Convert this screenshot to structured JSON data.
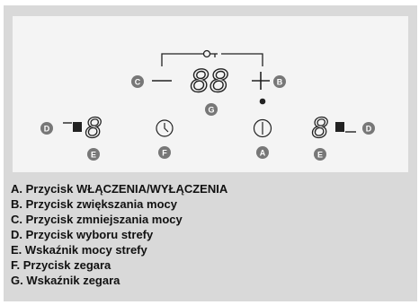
{
  "colors": {
    "panel_bg": "#f4f4f4",
    "frame_bg": "#d9d9d9",
    "line": "#222222",
    "badge_fill": "#777777",
    "badge_text": "#ffffff"
  },
  "icons": {
    "lock": "key-lock-icon",
    "minus": "minus-icon",
    "plus": "plus-icon",
    "timer": "clock-icon",
    "power": "power-icon",
    "zone_left": "zone-select-left-icon",
    "zone_right": "zone-select-right-icon"
  },
  "display": {
    "timer_digits": "88",
    "zone_left_digit": "8",
    "zone_right_digit": "8"
  },
  "callouts": {
    "A": "A",
    "B": "B",
    "C": "C",
    "D": "D",
    "E": "E",
    "F": "F",
    "G": "G"
  },
  "legend": [
    "A. Przycisk WŁĄCZENIA/WYŁĄCZENIA",
    "B. Przycisk zwiększania mocy",
    "C. Przycisk zmniejszania mocy",
    "D. Przycisk wyboru strefy",
    "E. Wskaźnik mocy strefy",
    "F. Przycisk zegara",
    "G. Wskaźnik zegara"
  ]
}
